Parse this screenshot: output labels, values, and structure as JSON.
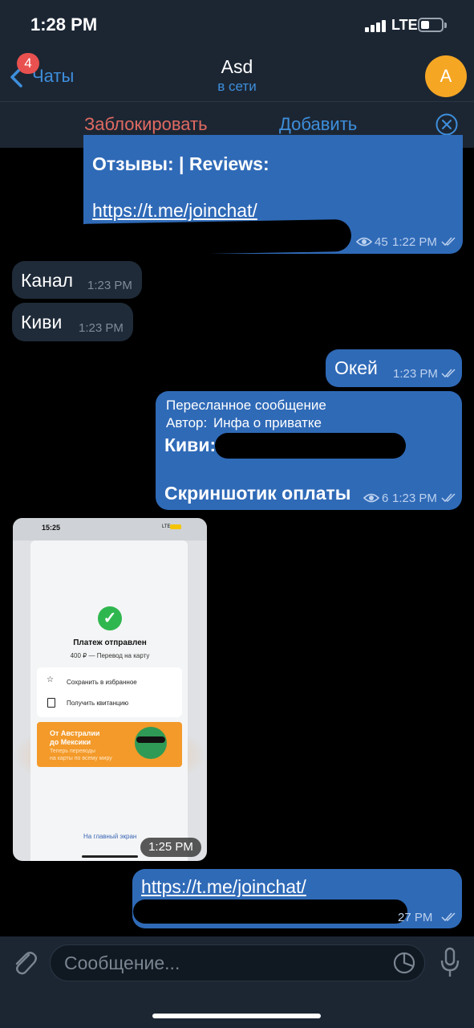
{
  "status_bar": {
    "time": "1:28 PM",
    "network": "LTE"
  },
  "nav": {
    "back_label": "Чаты",
    "unread_badge": "4",
    "title": "Asd",
    "subtitle": "в сети",
    "avatar_letter": "A"
  },
  "action_bar": {
    "block_label": "Заблокировать",
    "add_label": "Добавить"
  },
  "messages": {
    "m1": {
      "label": "Отзывы: | Reviews:",
      "link": "https://t.me/joinchat/",
      "views": "45",
      "time": "1:22 PM"
    },
    "m2": {
      "text": "Канал",
      "time": "1:23 PM"
    },
    "m3": {
      "text": "Киви",
      "time": "1:23 PM"
    },
    "m4": {
      "text": "Окей",
      "time": "1:23 PM"
    },
    "m5": {
      "forward_header": "Пересланное сообщение",
      "author_prefix": "Автор:",
      "author": "Инфа о приватке",
      "line1": "Киви:",
      "line2": "Скриншотик оплаты",
      "views": "6",
      "time": "1:23 PM"
    },
    "m6": {
      "time": "1:25 PM",
      "screenshot": {
        "time": "15:25",
        "network": "LTE",
        "title": "Платеж отправлен",
        "subtitle": "400 ₽ — Перевод на карту",
        "option1": "Сохранить в избранное",
        "option2": "Получить квитанцию",
        "promo_title_1": "От Австралии",
        "promo_title_2": "до Мексики",
        "promo_sub_1": "Теперь переводы",
        "promo_sub_2": "на карты по всему миру",
        "home_link": "На главный экран"
      }
    },
    "m7": {
      "link": "https://t.me/joinchat/",
      "time": "1:27 PM",
      "time_visible": "27 PM"
    }
  },
  "composer": {
    "placeholder": "Сообщение..."
  },
  "colors": {
    "accent": "#3e8fdc",
    "outgoing": "#2f6ab7",
    "incoming": "#1f2b39",
    "destructive": "#e06a62",
    "bar": "#1c2633"
  }
}
